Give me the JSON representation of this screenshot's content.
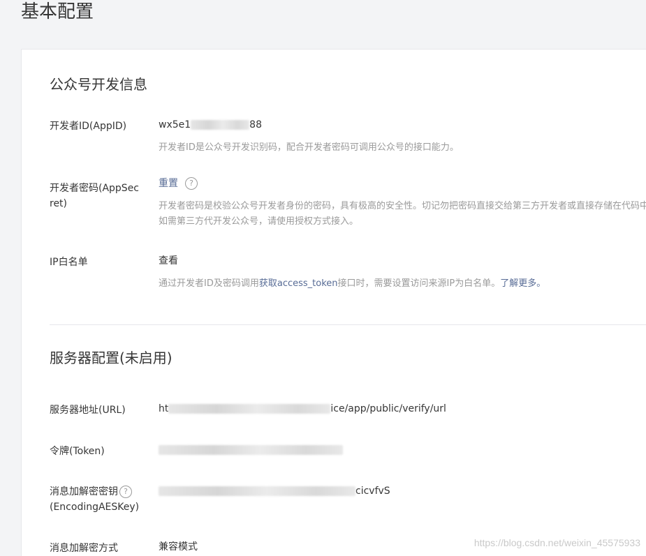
{
  "page": {
    "title": "基本配置"
  },
  "developer_info": {
    "title": "公众号开发信息",
    "appid": {
      "label": "开发者ID(AppID)",
      "value_prefix": "wx5e1",
      "value_suffix": "88",
      "desc": "开发者ID是公众号开发识别码，配合开发者密码可调用公众号的接口能力。"
    },
    "appsecret": {
      "label": "开发者密码(AppSecret)",
      "action": "重置",
      "help": "?",
      "desc": "开发者密码是校验公众号开发者身份的密码，具有极高的安全性。切记勿把密码直接交给第三方开发者或直接存储在代码中。如需第三方代开发公众号，请使用授权方式接入。"
    },
    "ip_whitelist": {
      "label": "IP白名单",
      "action": "查看",
      "desc_part1": "通过开发者ID及密码调用",
      "desc_link1": "获取access_token",
      "desc_part2": "接口时，需要设置访问来源IP为白名单。",
      "desc_link2": "了解更多。"
    }
  },
  "server_config": {
    "title": "服务器配置(未启用)",
    "url": {
      "label": "服务器地址(URL)",
      "value_prefix": "ht",
      "value_suffix": "ice/app/public/verify/url"
    },
    "token": {
      "label": "令牌(Token)"
    },
    "aeskey": {
      "label_line1": "消息加解密密钥",
      "label_line2": "(EncodingAESKey)",
      "help": "?",
      "value_suffix": "cicvfvS"
    },
    "encrypt_mode": {
      "label": "消息加解密方式",
      "value": "兼容模式"
    }
  },
  "watermark": "https://blog.csdn.net/weixin_45575933",
  "colors": {
    "link": "#576b95",
    "muted": "#9a9a9a",
    "text": "#353535",
    "background": "#f3f4f6"
  }
}
